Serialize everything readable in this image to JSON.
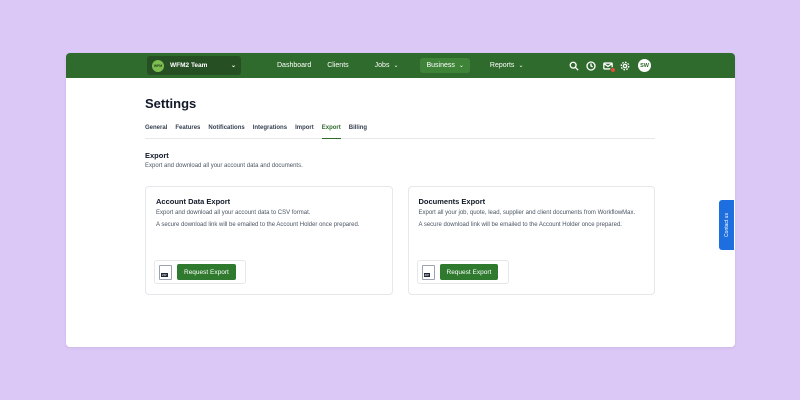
{
  "nav": {
    "team_logo": "WFM",
    "team_name": "WFM2 Team",
    "links": {
      "dashboard": "Dashboard",
      "clients": "Clients",
      "jobs": "Jobs",
      "business": "Business",
      "reports": "Reports"
    },
    "avatar_initials": "SW"
  },
  "page": {
    "title": "Settings",
    "tabs": [
      "General",
      "Features",
      "Notifications",
      "Integrations",
      "Import",
      "Export",
      "Billing"
    ],
    "active_tab": "Export"
  },
  "export": {
    "title": "Export",
    "description": "Export and download all your account data and documents."
  },
  "cards": [
    {
      "title": "Account Data Export",
      "description": "Export and download all your account data to CSV format.",
      "note": "A secure download link will be emailed to the Account Holder once prepared.",
      "file_label": "ZIP",
      "button": "Request Export"
    },
    {
      "title": "Documents Export",
      "description": "Export all your job, quote, lead, supplier and client documents from WorkflowMax.",
      "note": "A secure download link will be emailed to the Account Holder once prepared.",
      "file_label": "ZIP",
      "button": "Request Export"
    }
  ],
  "contact": "Contact us",
  "colors": {
    "brand": "#2f6b2c",
    "accent": "#1d6fe0",
    "background": "#dcc8f7"
  },
  "icons": [
    "search-icon",
    "clock-icon",
    "mail-icon",
    "gear-icon",
    "chevron-down-icon",
    "zip-file-icon",
    "chat-icon"
  ]
}
